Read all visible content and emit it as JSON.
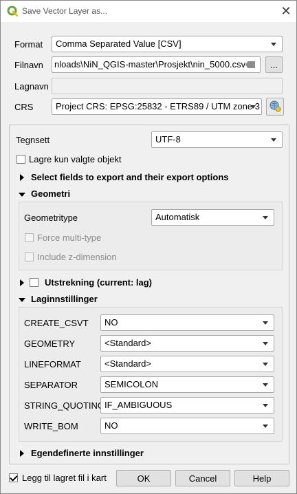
{
  "window": {
    "title": "Save Vector Layer as...",
    "brand_color": "#6ea33a"
  },
  "form": {
    "format_label": "Format",
    "format_value": "Comma Separated Value [CSV]",
    "filename_label": "Filnavn",
    "filename_value": "nloads\\NiN_QGIS-master\\Prosjekt\\nin_5000.csv",
    "browse_label": "...",
    "layername_label": "Lagnavn",
    "layername_value": "",
    "crs_label": "CRS",
    "crs_value": "Project CRS: EPSG:25832 - ETRS89 / UTM zone 3"
  },
  "options": {
    "encoding_label": "Tegnsett",
    "encoding_value": "UTF-8",
    "save_selected_label": "Lagre kun valgte objekt",
    "save_selected_checked": false,
    "select_fields_label": "Select fields to export and their export options",
    "geometry_section_label": "Geometri",
    "geometry_type_label": "Geometritype",
    "geometry_type_value": "Automatisk",
    "force_multi_label": "Force multi-type",
    "include_z_label": "Include z-dimension",
    "extent_label": "Utstrekning (current: lag)",
    "layer_settings_label": "Laginnstillinger",
    "custom_settings_label": "Egendefinerte innstillinger"
  },
  "layer_options": [
    {
      "name": "CREATE_CSVT",
      "value": "NO"
    },
    {
      "name": "GEOMETRY",
      "value": "<Standard>"
    },
    {
      "name": "LINEFORMAT",
      "value": "<Standard>"
    },
    {
      "name": "SEPARATOR",
      "value": "SEMICOLON"
    },
    {
      "name": "STRING_QUOTING",
      "value": "IF_AMBIGUOUS"
    },
    {
      "name": "WRITE_BOM",
      "value": "NO"
    }
  ],
  "footer": {
    "add_to_map_label": "Legg til lagret fil i kart",
    "add_to_map_checked": true,
    "ok_label": "OK",
    "cancel_label": "Cancel",
    "help_label": "Help"
  },
  "icons": {
    "app": "qgis-logo-icon",
    "close": "close-icon",
    "clear": "clear-field-icon",
    "crs_select": "globe-crs-icon",
    "dropdown": "chevron-down-icon",
    "expand": "triangle-right-icon",
    "collapse": "triangle-down-icon"
  }
}
